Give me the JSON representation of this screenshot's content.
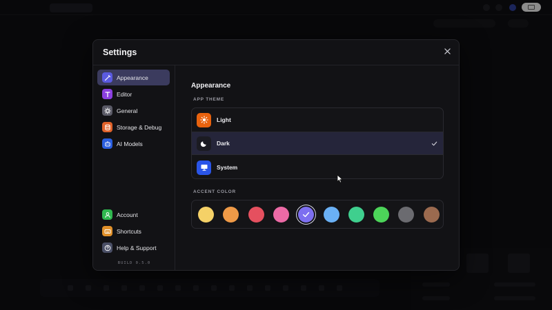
{
  "modal": {
    "title": "Settings",
    "close_icon": "close-icon"
  },
  "sidebar": {
    "top_items": [
      {
        "label": "Appearance",
        "icon": "brush-icon",
        "color": "#5b5be0",
        "active": true
      },
      {
        "label": "Editor",
        "icon": "text-icon",
        "color": "#8b3fe0",
        "active": false
      },
      {
        "label": "General",
        "icon": "gear-icon",
        "color": "#5a5a66",
        "active": false
      },
      {
        "label": "Storage & Debug",
        "icon": "database-icon",
        "color": "#e0622a",
        "active": false
      },
      {
        "label": "AI Models",
        "icon": "robot-icon",
        "color": "#2a5ee0",
        "active": false
      }
    ],
    "bottom_items": [
      {
        "label": "Account",
        "icon": "user-icon",
        "color": "#2fb84f"
      },
      {
        "label": "Shortcuts",
        "icon": "keyboard-icon",
        "color": "#e0902a"
      },
      {
        "label": "Help & Support",
        "icon": "help-icon",
        "color": "#4a4f66"
      }
    ],
    "build": "BUILD 0.5.0"
  },
  "content": {
    "section_title": "Appearance",
    "app_theme_label": "APP THEME",
    "themes": [
      {
        "label": "Light",
        "icon": "sun-icon",
        "color": "#e8620e",
        "selected": false
      },
      {
        "label": "Dark",
        "icon": "moon-icon",
        "color": "#1b1b22",
        "selected": true
      },
      {
        "label": "System",
        "icon": "monitor-icon",
        "color": "#2a55e8",
        "selected": false
      }
    ],
    "accent_color_label": "ACCENT COLOR",
    "accent_colors": [
      "#f5d167",
      "#ef9a47",
      "#e5505f",
      "#ec6aa6",
      "#7d6ff0",
      "#6ab0f5",
      "#3fcf8e",
      "#4cd459",
      "#6b6b70",
      "#9b6a4f"
    ],
    "selected_accent": 4
  }
}
